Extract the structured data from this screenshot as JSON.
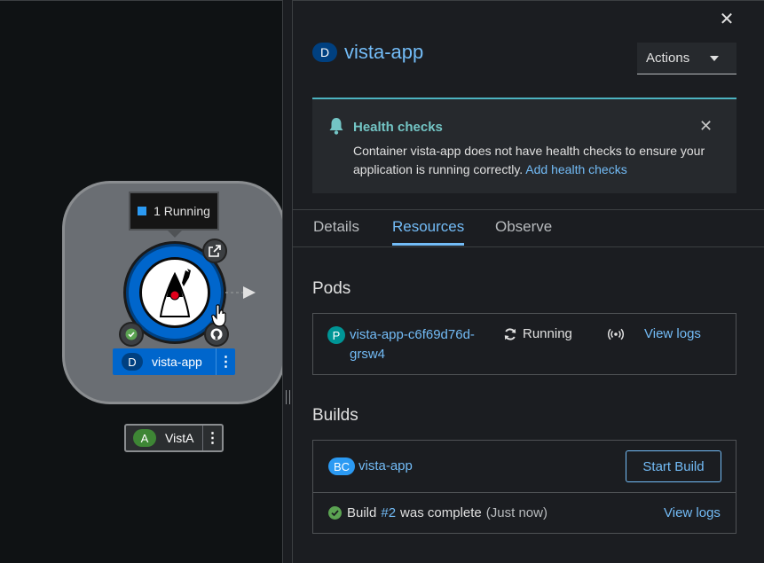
{
  "topology": {
    "tooltip_text": "1 Running",
    "node": {
      "badge": "D",
      "label": "vista-app",
      "kebab": "⋮"
    },
    "application": {
      "badge": "A",
      "label": "VistA",
      "kebab": "⋮"
    }
  },
  "panel": {
    "close_glyph": "✕",
    "resource_badge": "D",
    "title": "vista-app",
    "actions_label": "Actions",
    "alert": {
      "title": "Health checks",
      "close_glyph": "✕",
      "body": "Container vista-app does not have health checks to ensure your application is running correctly.",
      "link": "Add health checks"
    },
    "tabs": [
      {
        "label": "Details"
      },
      {
        "label": "Resources"
      },
      {
        "label": "Observe"
      }
    ],
    "pods": {
      "heading": "Pods",
      "badge": "P",
      "name": "vista-app-c6f69d76d-grsw4",
      "status": "Running",
      "logs_link": "View logs"
    },
    "builds": {
      "heading": "Builds",
      "badge": "BC",
      "name": "vista-app",
      "start_build_label": "Start Build",
      "status_prefix": "Build",
      "build_number": "#2",
      "status_suffix": "was complete",
      "when": "(Just now)",
      "logs_link": "View logs"
    }
  },
  "colors": {
    "link": "#73bcf7",
    "node_blue": "#0066cc",
    "alert_accent": "#4cb3c0",
    "success": "#5ba352"
  }
}
